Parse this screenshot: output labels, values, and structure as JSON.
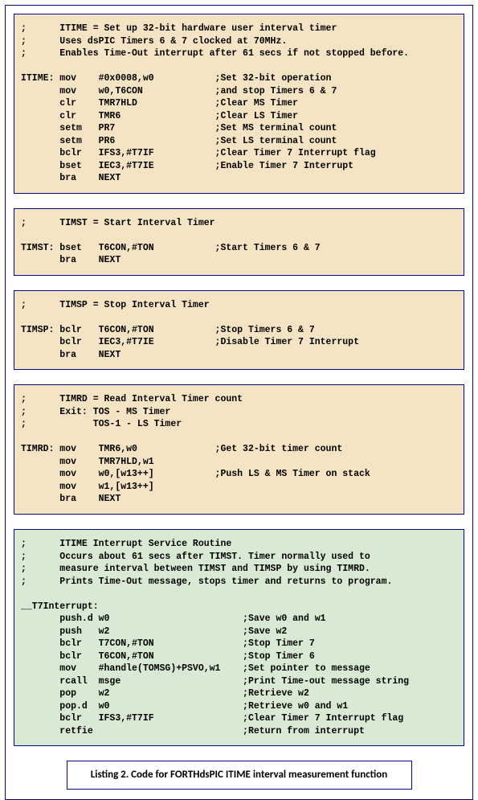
{
  "block1": ";      ITIME = Set up 32-bit hardware user interval timer\n;      Uses dsPIC Timers 6 & 7 clocked at 70MHz.\n;      Enables Time-Out interrupt after 61 secs if not stopped before.\n\nITIME: mov    #0x0008,w0           ;Set 32-bit operation\n       mov    w0,T6CON             ;and stop Timers 6 & 7\n       clr    TMR7HLD              ;Clear MS Timer\n       clr    TMR6                 ;Clear LS Timer\n       setm   PR7                  ;Set MS terminal count\n       setm   PR6                  ;Set LS terminal count\n       bclr   IFS3,#T7IF           ;Clear Timer 7 Interrupt flag\n       bset   IEC3,#T7IE           ;Enable Timer 7 Interrupt\n       bra    NEXT",
  "block2": ";      TIMST = Start Interval Timer\n\nTIMST: bset   T6CON,#TON           ;Start Timers 6 & 7\n       bra    NEXT",
  "block3": ";      TIMSP = Stop Interval Timer\n\nTIMSP: bclr   T6CON,#TON           ;Stop Timers 6 & 7\n       bclr   IEC3,#T7IE           ;Disable Timer 7 Interrupt\n       bra    NEXT",
  "block4": ";      TIMRD = Read Interval Timer count\n;      Exit: TOS - MS Timer\n;            TOS-1 - LS Timer\n\nTIMRD: mov    TMR6,w0              ;Get 32-bit timer count\n       mov    TMR7HLD,w1\n       mov    w0,[w13++]           ;Push LS & MS Timer on stack\n       mov    w1,[w13++]\n       bra    NEXT",
  "block5": ";      ITIME Interrupt Service Routine\n;      Occurs about 61 secs after TIMST. Timer normally used to\n;      measure interval between TIMST and TIMSP by using TIMRD.\n;      Prints Time-Out message, stops timer and returns to program.\n\n__T7Interrupt:\n       push.d w0                        ;Save w0 and w1\n       push   w2                        ;Save w2\n       bclr   T7CON,#TON                ;Stop Timer 7\n       bclr   T6CON,#TON                ;Stop Timer 6\n       mov    #handle(TOMSG)+PSVO,w1    ;Set pointer to message\n       rcall  msge                      ;Print Time-out message string\n       pop    w2                        ;Retrieve w2\n       pop.d  w0                        ;Retrieve w0 and w1\n       bclr   IFS3,#T7IF                ;Clear Timer 7 Interrupt flag\n       retfie                           ;Return from interrupt",
  "caption": "Listing 2. Code for FORTHdsPIC ITIME interval measurement function"
}
